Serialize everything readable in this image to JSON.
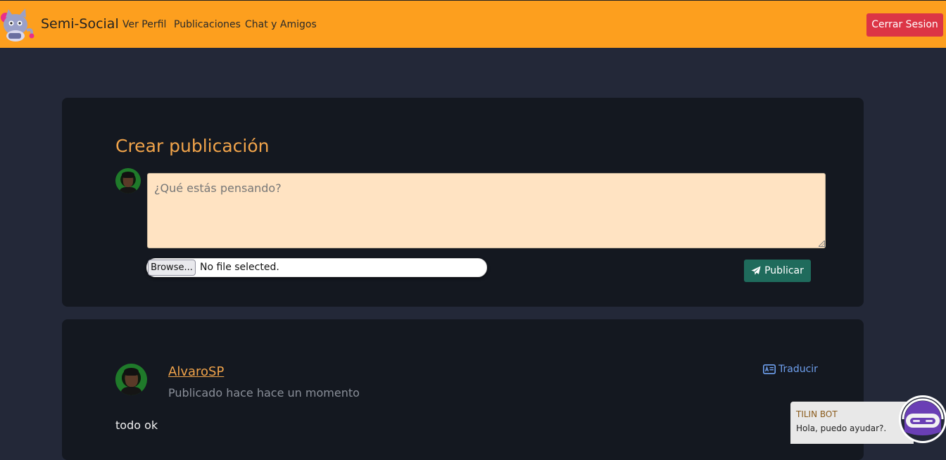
{
  "navbar": {
    "brand": "Semi-Social",
    "links": [
      "Ver Perfil",
      "Publicaciones",
      "Chat y Amigos"
    ],
    "logout_label": "Cerrar Sesion",
    "bg_color": "#fd9f1e"
  },
  "create_post": {
    "title": "Crear publicación",
    "placeholder": "¿Qué estás pensando?",
    "browse_label": "Browse...",
    "file_status": "No file selected.",
    "publish_label": "Publicar"
  },
  "post": {
    "author": "AlvaroSP",
    "time": "Publicado hace hace un momento",
    "translate_label": "Traducir",
    "body": "todo ok"
  },
  "bot": {
    "name": "TILIN BOT",
    "message": "Hola, puedo ayudar?."
  },
  "icons": {
    "logo": "cat-gamer-logo",
    "publish": "paper-plane-icon",
    "translate": "language-card-icon",
    "bot": "robot-icon"
  },
  "colors": {
    "page_bg": "#232838",
    "card_bg": "#141820",
    "accent": "#f0a34a",
    "logout": "#dc3545",
    "publish": "#1f6b5c",
    "link": "#6fa0ef"
  }
}
